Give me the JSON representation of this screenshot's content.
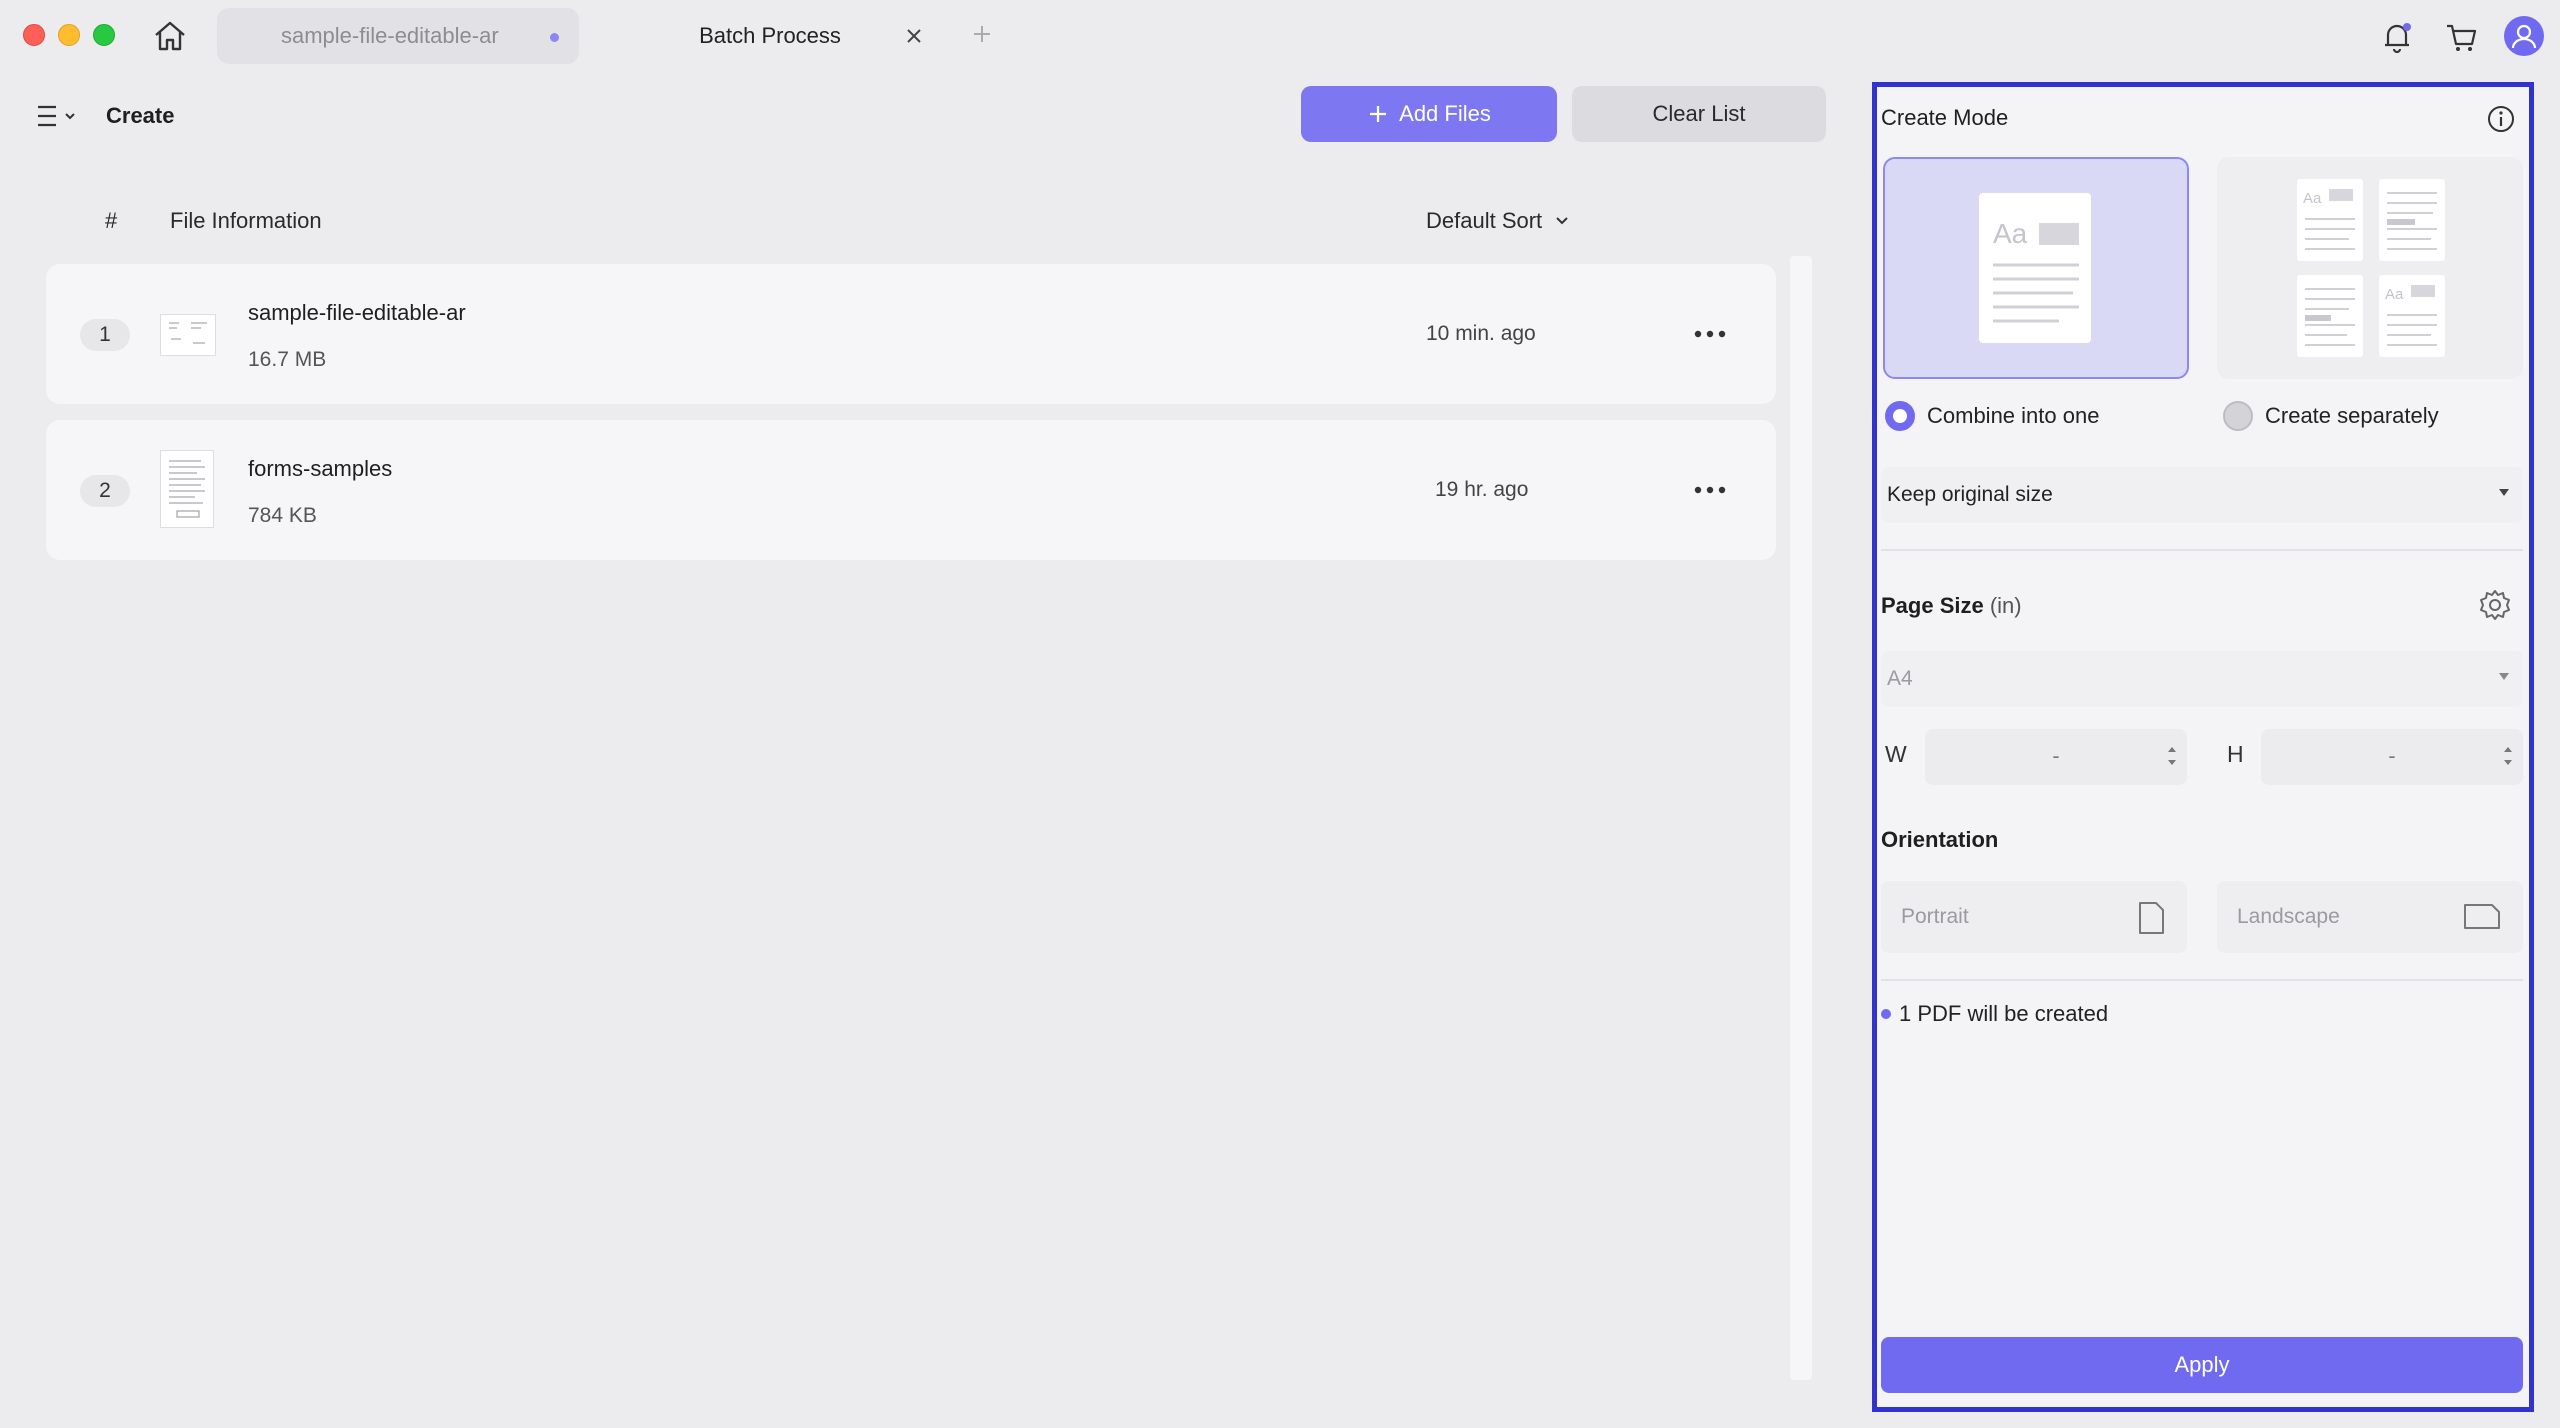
{
  "tabs": [
    {
      "label": "sample-file-editable-ar",
      "active": false,
      "unsaved": true
    },
    {
      "label": "Batch Process",
      "active": true
    }
  ],
  "toolbar": {
    "title": "Create",
    "add_files_label": "Add Files",
    "clear_list_label": "Clear List"
  },
  "list": {
    "col_index": "#",
    "col_info": "File Information",
    "sort_label": "Default Sort",
    "files": [
      {
        "index": "1",
        "name": "sample-file-editable-ar",
        "size": "16.7 MB",
        "time": "10 min. ago"
      },
      {
        "index": "2",
        "name": "forms-samples",
        "size": "784 KB",
        "time": "19 hr. ago"
      }
    ]
  },
  "panel": {
    "title": "Create Mode",
    "mode_combine_label": "Combine into one",
    "mode_separate_label": "Create separately",
    "selected_mode": "combine",
    "size_option": "Keep original size",
    "page_size_title": "Page Size",
    "page_size_unit": "(in)",
    "page_size_value": "A4",
    "width_label": "W",
    "width_value": "-",
    "height_label": "H",
    "height_value": "-",
    "orientation_title": "Orientation",
    "portrait_label": "Portrait",
    "landscape_label": "Landscape",
    "status_text": "1 PDF will be created",
    "apply_label": "Apply"
  },
  "colors": {
    "accent": "#6f6af0",
    "highlight_border": "#3232cc"
  }
}
